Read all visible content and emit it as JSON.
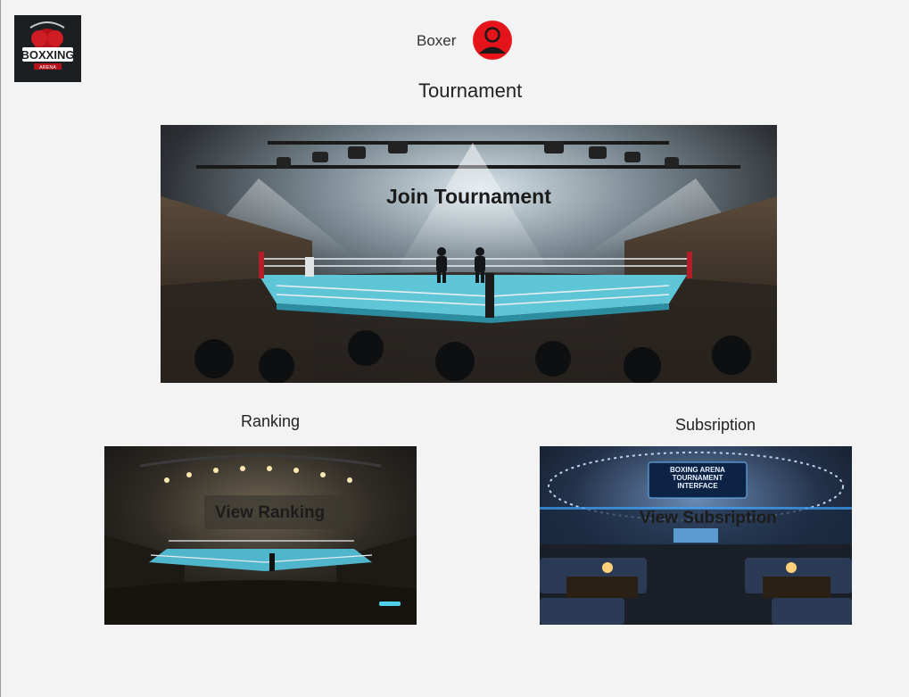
{
  "header": {
    "logo_text": "BOXXING",
    "logo_subtext": "ARENA",
    "role_label": "Boxer",
    "page_title": "Tournament"
  },
  "tournament": {
    "button_label": "Join Tournament"
  },
  "ranking": {
    "section_title": "Ranking",
    "button_label": "View Ranking"
  },
  "subscription": {
    "section_title": "Subsription",
    "button_label": "View Subsription",
    "screen_text_line1": "BOXING ARENA",
    "screen_text_line2": "TOURNAMENT",
    "screen_text_line3": "INTERFACE"
  },
  "colors": {
    "avatar_red": "#e5141b",
    "background": "#f3f3f3"
  }
}
